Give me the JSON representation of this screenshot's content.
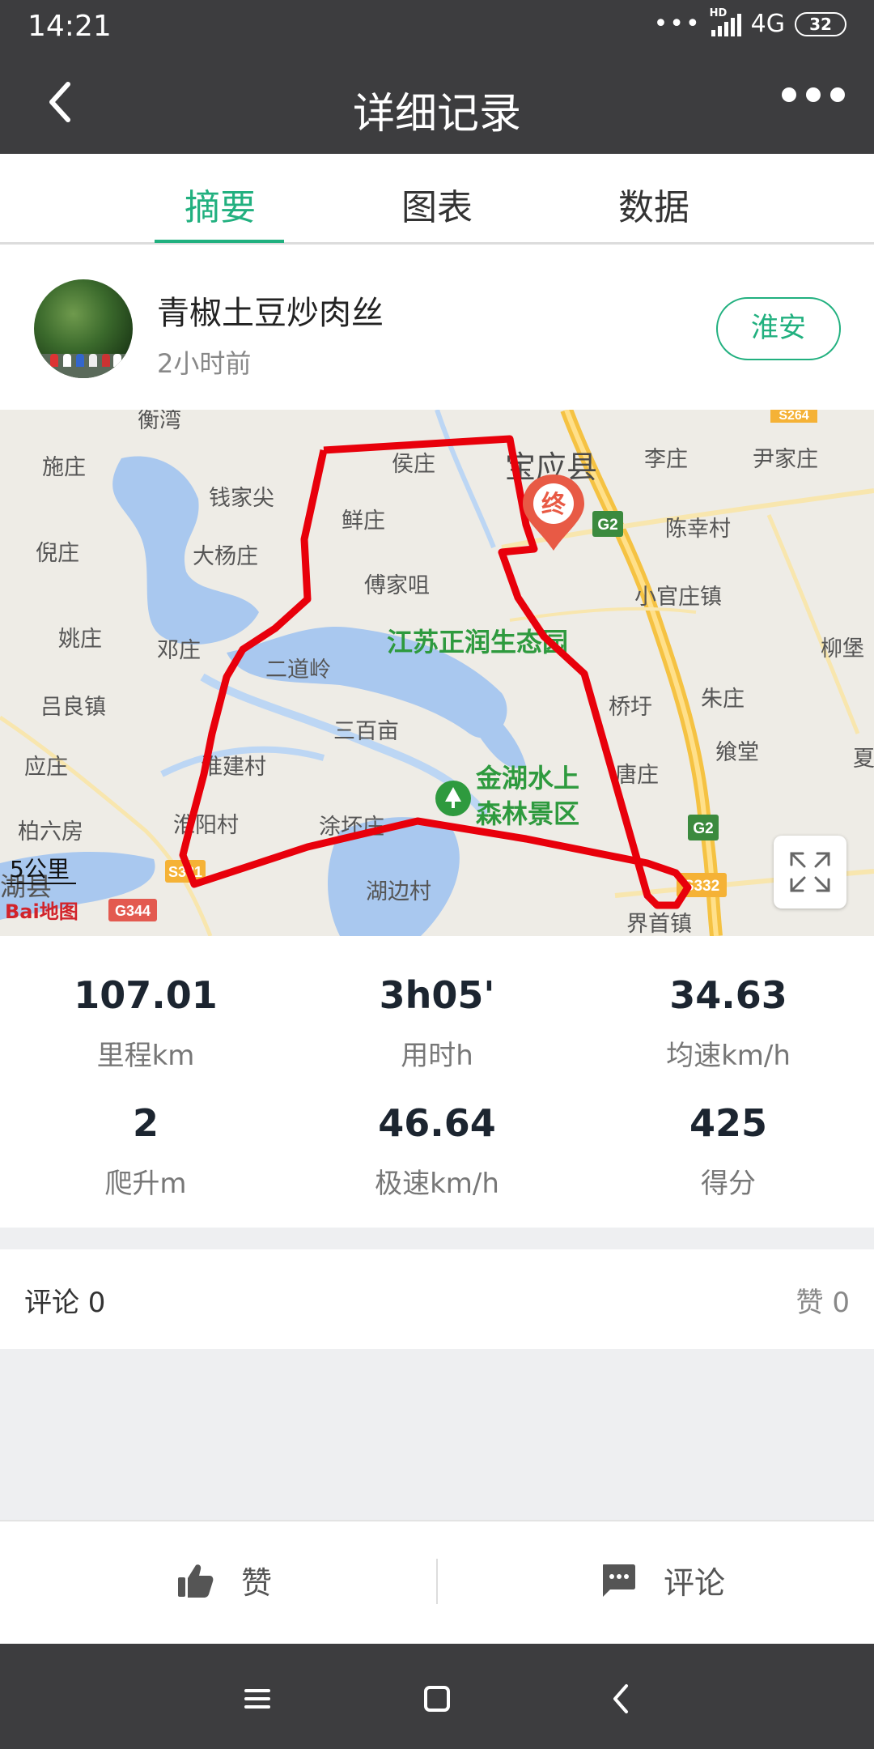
{
  "status_bar": {
    "time": "14:21",
    "network": "4G",
    "battery": "32"
  },
  "header": {
    "title": "详细记录"
  },
  "tabs": [
    {
      "label": "摘要",
      "active": true
    },
    {
      "label": "图表",
      "active": false
    },
    {
      "label": "数据",
      "active": false
    }
  ],
  "user": {
    "name": "青椒土豆炒肉丝",
    "time_ago": "2小时前",
    "city_button": "淮安"
  },
  "map": {
    "scale_label": "5公里",
    "end_marker": "终",
    "baidu_logo": "Bai地图",
    "place_labels": [
      "衡湾",
      "施庄",
      "钱家尖",
      "倪庄",
      "大杨庄",
      "姚庄",
      "邓庄",
      "吕良镇",
      "应庄",
      "柏六房",
      "湖县",
      "侯庄",
      "宝应县",
      "鲜庄",
      "傅家咀",
      "二道岭",
      "三百亩",
      "淮建村",
      "淮阳村",
      "涂坏庄",
      "湖边村",
      "李庄",
      "尹家庄",
      "陈幸村",
      "小官庄镇",
      "柳堡",
      "桥圩",
      "朱庄",
      "飨堂",
      "夏",
      "唐庄",
      "界首镇"
    ],
    "road_labels": [
      "S264",
      "G2",
      "G2",
      "S331",
      "S332",
      "G344"
    ],
    "green_labels": [
      "江苏正润生态园",
      "金湖水上",
      "森林景区"
    ],
    "colors": {
      "route": "#e8000b",
      "water": "#a9c8ef",
      "marker": "#e85a45",
      "park_text": "#2e9a3e"
    }
  },
  "stats": [
    {
      "value": "107.01",
      "label": "里程km"
    },
    {
      "value": "3h05'",
      "label": "用时h"
    },
    {
      "value": "34.63",
      "label": "均速km/h"
    },
    {
      "value": "2",
      "label": "爬升m"
    },
    {
      "value": "46.64",
      "label": "极速km/h"
    },
    {
      "value": "425",
      "label": "得分"
    }
  ],
  "comments": {
    "comment_label": "评论 0",
    "like_label": "赞 0"
  },
  "actions": {
    "like": "赞",
    "comment": "评论"
  },
  "colors": {
    "accent": "#21b07f",
    "dark_bar": "#3d3d3f"
  }
}
